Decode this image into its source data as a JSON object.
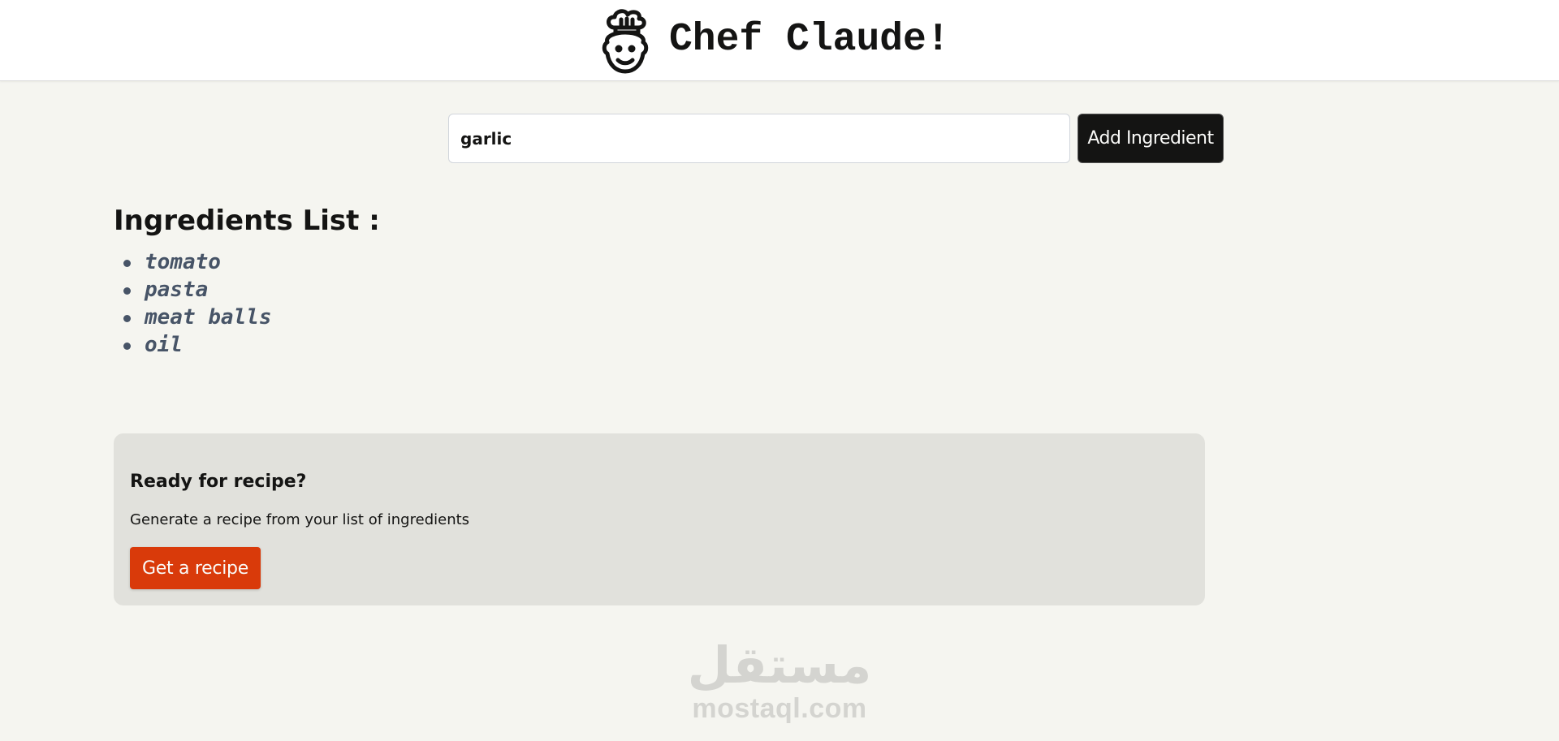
{
  "header": {
    "title": "Chef Claude!",
    "logo_icon": "chef-icon"
  },
  "form": {
    "input_value": "garlic",
    "add_button_label": "Add Ingredient"
  },
  "ingredients": {
    "title": "Ingredients List :",
    "items": [
      "tomato",
      "pasta",
      "meat balls",
      "oil"
    ]
  },
  "recipe": {
    "heading": "Ready for recipe?",
    "description": "Generate a recipe from your list of ingredients",
    "button_label": "Get a recipe"
  },
  "watermark": {
    "arabic": "مستقل",
    "url": "mostaql.com"
  },
  "colors": {
    "accent": "#d93a0a",
    "dark_button": "#141413",
    "page_background": "#f5f5f0",
    "card_background": "#e1e1dc"
  }
}
